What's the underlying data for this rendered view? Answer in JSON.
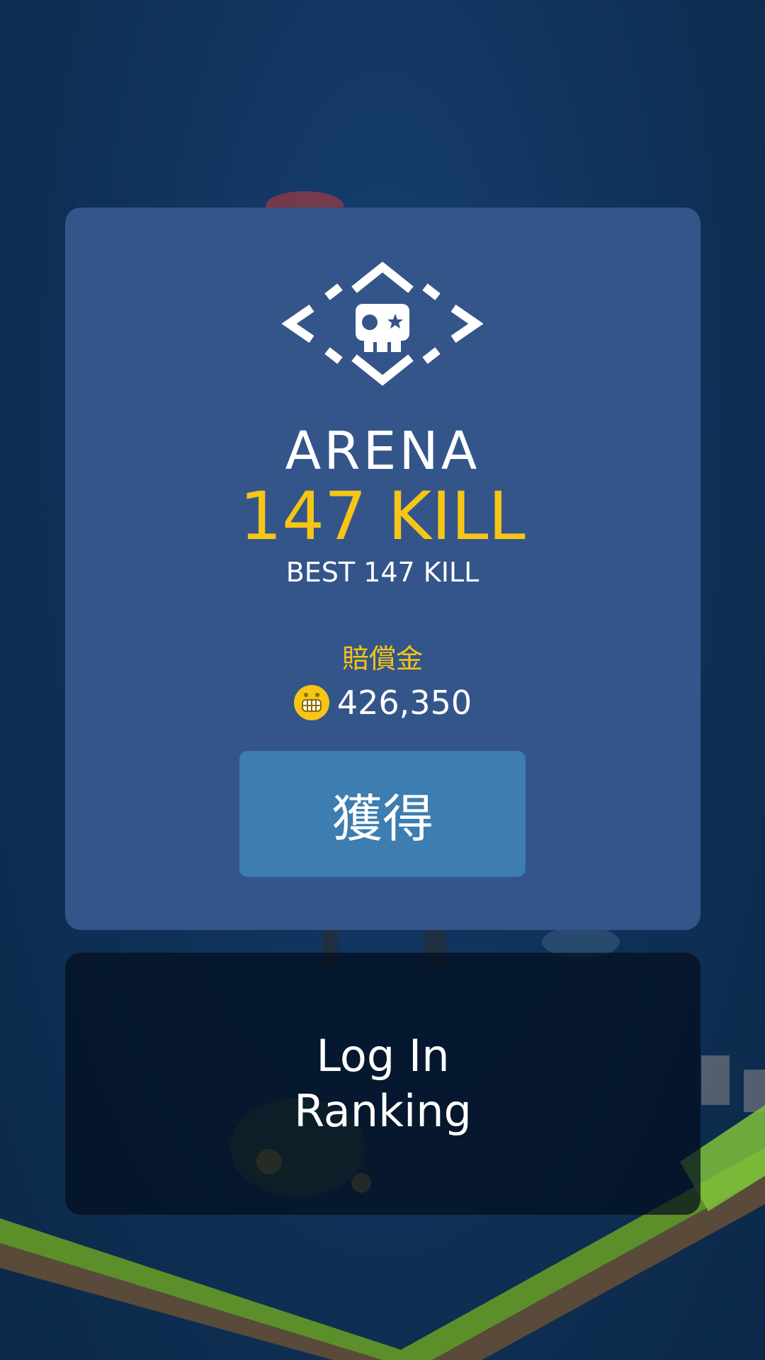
{
  "result": {
    "mode": "ARENA",
    "kills": "147 KILL",
    "best": "BEST 147 KILL"
  },
  "reward": {
    "label": "賠償金",
    "amount": "426,350",
    "icon": "grinning-coin-icon"
  },
  "buttons": {
    "claim_label": "獲得"
  },
  "ranking": {
    "line1": "Log In",
    "line2": "Ranking"
  },
  "colors": {
    "card": "#34558a",
    "accent_yellow": "#f6c516",
    "button": "#3d7db0",
    "background": "#0f3158"
  },
  "icons": {
    "mode_emblem": "skull-diamond-icon"
  }
}
